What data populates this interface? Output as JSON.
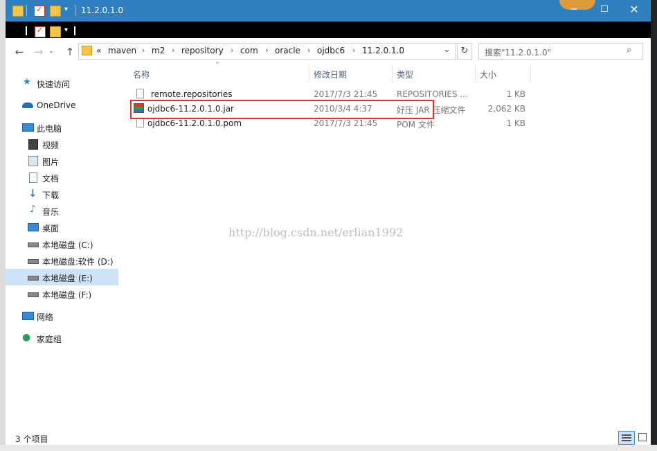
{
  "window": {
    "title": "11.2.0.1.0"
  },
  "nav": {
    "back": "←",
    "forward": "→",
    "up": "↑"
  },
  "address": {
    "prefix": "«",
    "crumbs": [
      "maven",
      "m2",
      "repository",
      "com",
      "oracle",
      "ojdbc6",
      "11.2.0.1.0"
    ],
    "separator": "›",
    "dropdown": "⌄",
    "refresh": "↻"
  },
  "search": {
    "placeholder": "搜索\"11.2.0.1.0\""
  },
  "sidebar": {
    "items": [
      {
        "label": "快速访问",
        "icon": "star-icon"
      },
      {
        "label": "OneDrive",
        "icon": "cloud-icon"
      },
      {
        "label": "此电脑",
        "icon": "computer-icon"
      },
      {
        "label": "视频",
        "icon": "video-icon"
      },
      {
        "label": "图片",
        "icon": "picture-icon"
      },
      {
        "label": "文档",
        "icon": "document-icon"
      },
      {
        "label": "下载",
        "icon": "download-icon"
      },
      {
        "label": "音乐",
        "icon": "music-icon"
      },
      {
        "label": "桌面",
        "icon": "desktop-icon"
      },
      {
        "label": "本地磁盘 (C:)",
        "icon": "drive-icon"
      },
      {
        "label": "本地磁盘:软件 (D:)",
        "icon": "drive-icon"
      },
      {
        "label": "本地磁盘 (E:)",
        "icon": "drive-icon",
        "selected": true
      },
      {
        "label": "本地磁盘 (F:)",
        "icon": "drive-icon"
      },
      {
        "label": "网络",
        "icon": "network-icon"
      },
      {
        "label": "家庭组",
        "icon": "homegroup-icon"
      }
    ]
  },
  "columns": {
    "name": "名称",
    "date": "修改日期",
    "type": "类型",
    "size": "大小"
  },
  "files": [
    {
      "name": "remote.repositories",
      "date": "2017/7/3 21:45",
      "type": "REPOSITORIES ...",
      "size": "1 KB",
      "icon": "file-icon"
    },
    {
      "name": "ojdbc6-11.2.0.1.0.jar",
      "date": "2010/3/4 4:37",
      "type": "好压 JAR 压缩文件",
      "size": "2,062 KB",
      "icon": "archive-icon",
      "highlighted": true
    },
    {
      "name": "ojdbc6-11.2.0.1.0.pom",
      "date": "2017/7/3 21:45",
      "type": "POM 文件",
      "size": "1 KB",
      "icon": "file-icon"
    }
  ],
  "watermark": "http://blog.csdn.net/erlian1992",
  "status": {
    "count": "3 个项目"
  },
  "colors": {
    "titlebar": "#2f7fc1",
    "selection": "#cfe3f7",
    "highlight_box": "#e03030"
  }
}
